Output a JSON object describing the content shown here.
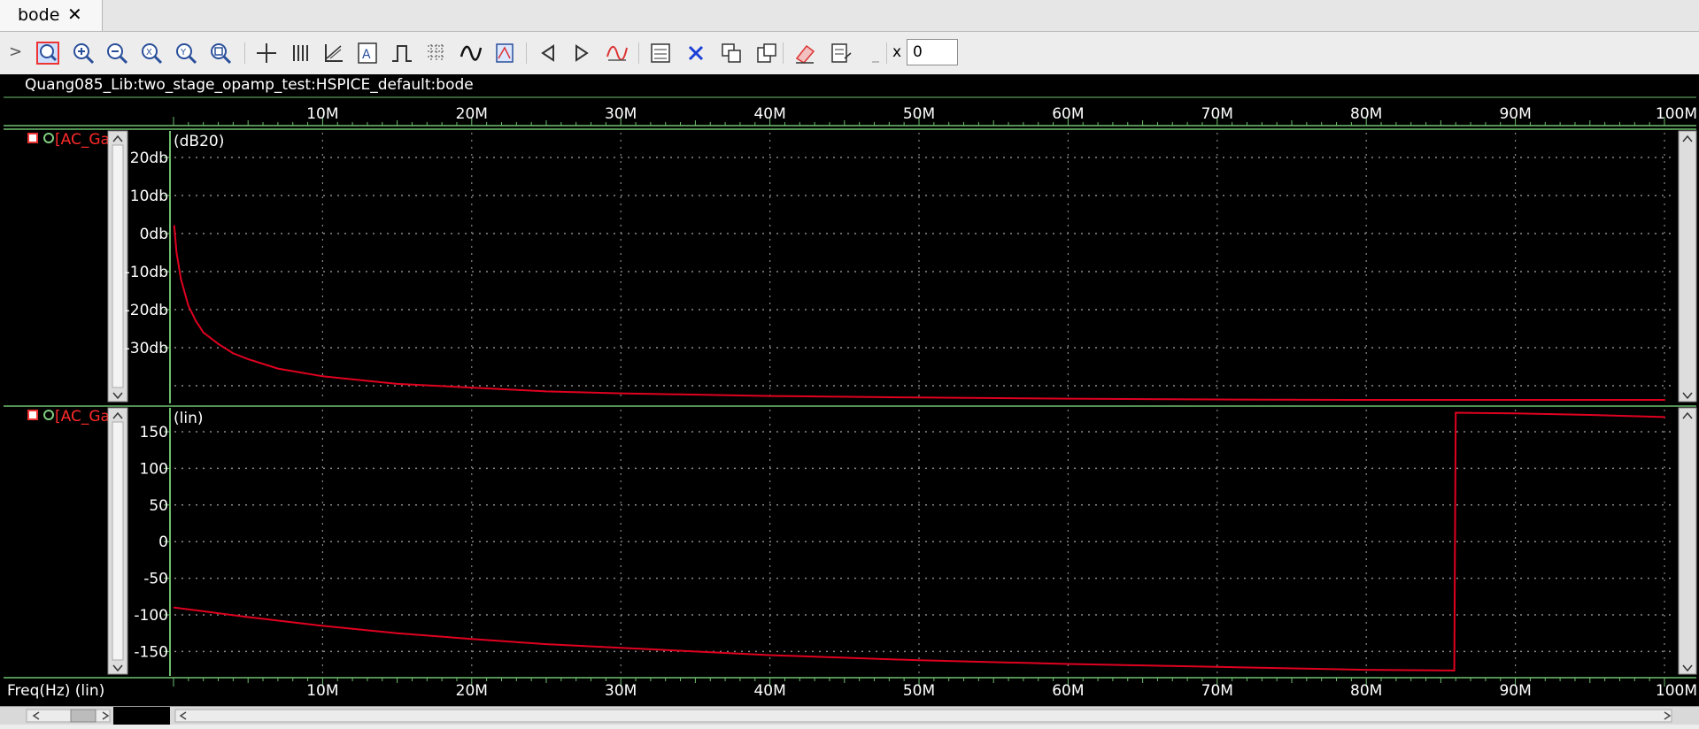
{
  "tab": {
    "label": "bode",
    "close_glyph": "✕"
  },
  "toolbar": {
    "tools": [
      {
        "name": "zoom-fit-icon"
      },
      {
        "name": "zoom-in-icon"
      },
      {
        "name": "zoom-out-icon"
      },
      {
        "name": "zoom-x-icon"
      },
      {
        "name": "zoom-y-icon"
      },
      {
        "name": "zoom-region-icon"
      },
      {
        "name": "crosshair-icon"
      },
      {
        "name": "strip-icon"
      },
      {
        "name": "axis-icon"
      },
      {
        "name": "annotation-icon"
      },
      {
        "name": "pulse-icon"
      },
      {
        "name": "grid-icon"
      },
      {
        "name": "waveform-icon"
      },
      {
        "name": "measure-icon"
      },
      {
        "name": "prev-icon"
      },
      {
        "name": "next-icon"
      },
      {
        "name": "trace-icon"
      },
      {
        "name": "frame-icon"
      },
      {
        "name": "delete-icon"
      },
      {
        "name": "copy-icon"
      },
      {
        "name": "paste-icon"
      },
      {
        "name": "eraser-icon"
      },
      {
        "name": "stack-icon"
      },
      {
        "name": "small-icon"
      }
    ],
    "x_label": "x",
    "x_value": "0"
  },
  "window": {
    "title": "Quang085_Lib:two_stage_opamp_test:HSPICE_default:bode"
  },
  "x_axis": {
    "ticks": [
      "10M",
      "20M",
      "30M",
      "40M",
      "50M",
      "60M",
      "70M",
      "80M",
      "90M",
      "100M"
    ],
    "label": "Freq(Hz) (lin)"
  },
  "strips": [
    {
      "trace_label": "[AC_Ga",
      "unit_label": "(dB20)",
      "y_ticks": [
        "20db",
        "10db",
        "0db",
        "-10db",
        "-20db",
        "-30db"
      ]
    },
    {
      "trace_label": "[AC_Ga",
      "unit_label": "(lin)",
      "y_ticks": [
        "150",
        "100",
        "50",
        "0",
        "-50",
        "-100",
        "-150"
      ]
    }
  ],
  "colors": {
    "trace": "#e00020",
    "grid": "#8a8a8a",
    "axis": "#6fbf6f",
    "text": "#ffffff"
  },
  "chart_data": [
    {
      "type": "line",
      "unit": "dB20",
      "x": [
        0.05,
        0.2,
        0.5,
        1,
        1.5,
        2,
        3,
        4,
        5,
        7,
        10,
        15,
        20,
        25,
        30,
        40,
        50,
        60,
        70,
        80,
        90,
        100
      ],
      "values": [
        2,
        -5,
        -12,
        -19,
        -23,
        -26,
        -29,
        -31.5,
        -33,
        -35.5,
        -37.5,
        -39.5,
        -40.5,
        -41.5,
        -42,
        -42.7,
        -43.1,
        -43.4,
        -43.6,
        -43.8,
        -43.9,
        -44
      ],
      "ylim": [
        -45,
        25
      ]
    },
    {
      "type": "line",
      "unit": "lin",
      "x": [
        0.05,
        2,
        5,
        10,
        15,
        20,
        25,
        30,
        40,
        50,
        60,
        70,
        80,
        85.9,
        86,
        90,
        95,
        100
      ],
      "values": [
        -90,
        -95,
        -103,
        -115,
        -125,
        -133,
        -140,
        -145,
        -155,
        -162,
        -167,
        -171,
        -175,
        -176,
        176,
        175,
        173,
        170
      ],
      "ylim": [
        -170,
        175
      ]
    }
  ]
}
